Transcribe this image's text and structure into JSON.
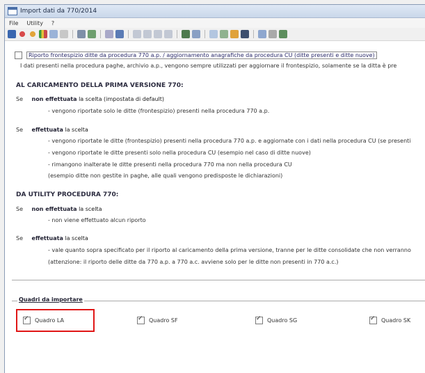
{
  "window": {
    "title": "Import dati da 770/2014"
  },
  "menu": [
    "File",
    "Utility",
    "?"
  ],
  "toolbar": {
    "icons": [
      "save-icon",
      "stop-icon",
      "forward-icon",
      "chart-icon",
      "copy-icon",
      "delete-icon",
      "print-icon",
      "print-preview-icon",
      "find-icon",
      "cards-icon",
      "first-icon",
      "prev-icon",
      "next-icon",
      "last-icon",
      "grid-icon",
      "filter-icon",
      "doc-icon",
      "export-icon",
      "color-icon",
      "disk-icon",
      "table-icon",
      "users-icon",
      "list-icon"
    ]
  },
  "options": {
    "riporto_label": "Riporto frontespizio ditte da procedura 770 a.p. / aggiornamento anagrafiche da procedura CU (ditte presenti e ditte nuove)",
    "riporto_note": "I dati presenti nella procedura paghe, archivio a.p., vengono sempre utilizzati per aggiornare il frontespizio, solamente se la ditta è pre"
  },
  "section1": {
    "heading": "AL CARICAMENTO DELLA PRIMA VERSIONE 770:",
    "se1_label": "Se",
    "se1_bold": "non effettuata",
    "se1_text": "la scelta (impostata di default)",
    "se1_detail": "- vengono riportate solo le ditte (frontespizio) presenti nella procedura 770 a.p.",
    "se2_label": "Se",
    "se2_bold": "effettuata",
    "se2_text": "la scelta",
    "se2_detail1": "- vengono riportate le ditte (frontespizio) presenti nella procedura 770 a.p. e aggiornate con i dati nella procedura CU (se presenti",
    "se2_detail2": "- vengono riportate le ditte presenti solo nella procedura CU (esempio nel caso di ditte nuove)",
    "se2_detail3": "- rimangono inalterate le ditte presenti nella procedura 770 ma non nella procedura CU",
    "se2_detail4": "(esempio ditte non gestite in paghe, alle quali vengono predisposte le dichiarazioni)"
  },
  "section2": {
    "heading": "DA UTILITY PROCEDURA 770:",
    "se1_label": "Se",
    "se1_bold": "non effettuata",
    "se1_text": "la scelta",
    "se1_detail": "- non viene effettuato alcun riporto",
    "se2_label": "Se",
    "se2_bold": "effettuata",
    "se2_text": "la scelta",
    "se2_detail1": "- vale quanto sopra specificato per il riporto al caricamento della prima versione, tranne per le ditte consolidate che non verranno",
    "se2_detail2": "(attenzione: il riporto delle ditte da 770 a.p. a 770 a.c. avviene solo per le ditte non presenti in 770 a.c.)"
  },
  "quadri": {
    "group_label": "Quadri da importare",
    "items": [
      {
        "label": "Quadro LA",
        "checked": true
      },
      {
        "label": "Quadro SF",
        "checked": true
      },
      {
        "label": "Quadro SG",
        "checked": true
      },
      {
        "label": "Quadro SK",
        "checked": true
      }
    ]
  },
  "colors": {
    "highlight": "#e01616",
    "titlebar": "#c9d7ea"
  }
}
